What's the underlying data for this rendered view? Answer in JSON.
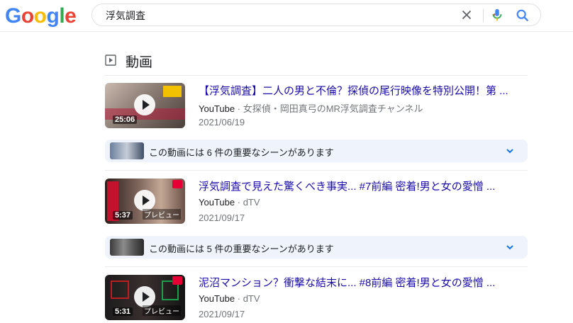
{
  "search": {
    "query": "浮気調査"
  },
  "logo": {
    "letters": [
      "G",
      "o",
      "o",
      "g",
      "l",
      "e"
    ],
    "colors": [
      "#4285f4",
      "#ea4335",
      "#fbbc05",
      "#4285f4",
      "#34a853",
      "#ea4335"
    ]
  },
  "section": {
    "title": "動画",
    "icon": "play-square-icon"
  },
  "videos": [
    {
      "title": "【浮気調査】二人の男と不倫？探偵の尾行映像を特別公開！第 ...",
      "site": "YouTube",
      "channel": "女探偵・岡田真弓のMR浮気調査チャンネル",
      "date": "2021/06/19",
      "duration": "25:06",
      "preview": "",
      "thumb_color": "#8a7b73"
    },
    {
      "title": "浮気調査で見えた驚くべき事実... #7前編 密着!男と女の愛憎 ...",
      "site": "YouTube",
      "channel": "dTV",
      "date": "2021/09/17",
      "duration": "5:37",
      "preview": "プレビュー",
      "thumb_color": "#5b4840"
    },
    {
      "title": "泥沼マンション？衝撃な結末に... #8前編 密着!男と女の愛憎 ...",
      "site": "YouTube",
      "channel": "dTV",
      "date": "2021/09/17",
      "duration": "5:31",
      "preview": "プレビュー",
      "thumb_color": "#2e2b2b"
    }
  ],
  "key_moments": [
    {
      "text": "この動画には 6 件の重要なシーンがあります"
    },
    {
      "text": "この動画には 5 件の重要なシーンがあります"
    }
  ],
  "separator": "·",
  "colors": {
    "link": "#1a0dab",
    "meta": "#70757a",
    "key_moment_bg": "#eef3fc",
    "accent_blue": "#4285f4"
  }
}
